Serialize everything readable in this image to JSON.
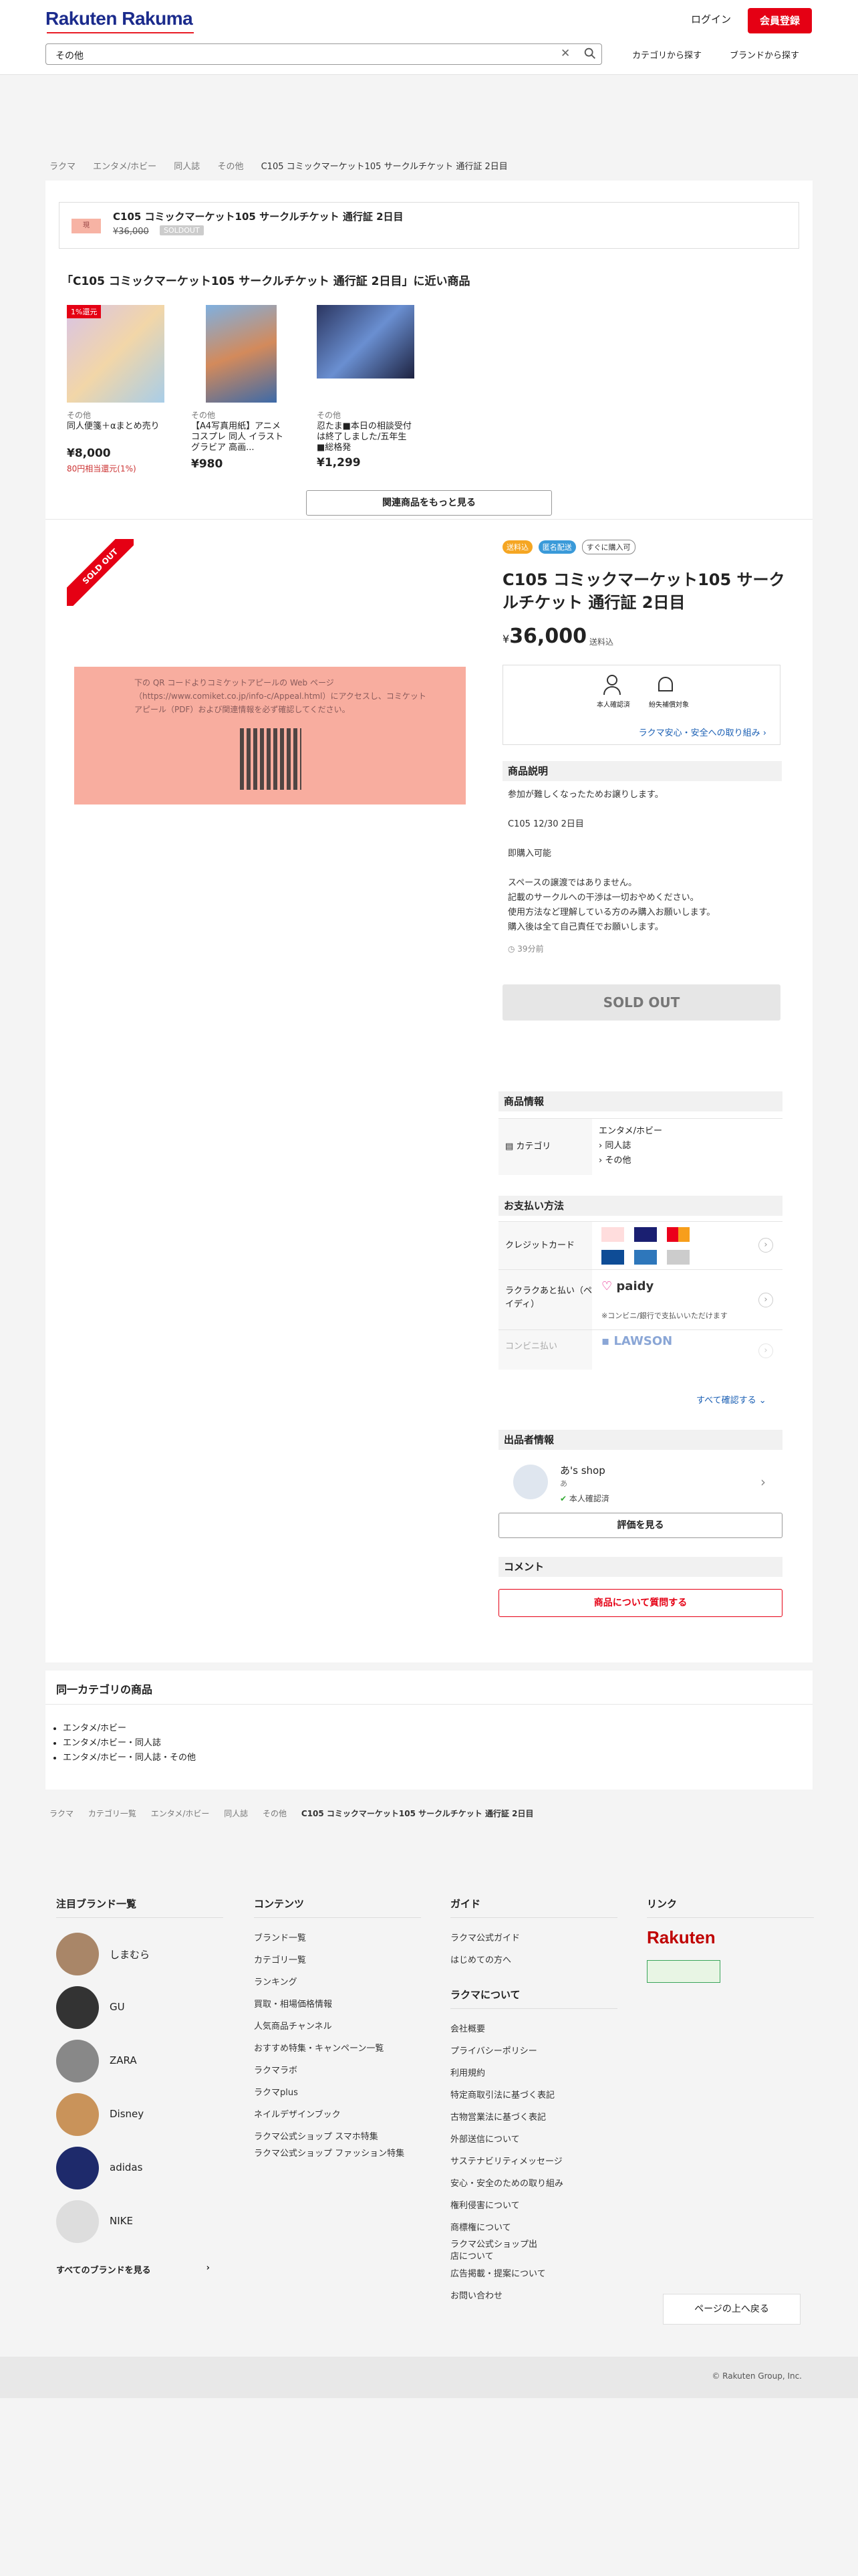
{
  "header": {
    "logo": "Rakuten Rakuma",
    "login": "ログイン",
    "register": "会員登録",
    "search_value": "その他",
    "nav_category": "カテゴリから探す",
    "nav_brand": "ブランドから探す"
  },
  "breadcrumb": [
    "ラクマ",
    "エンタメ/ホビー",
    "同人誌",
    "その他",
    "C105 コミックマーケット105 サークルチケット 通行証 2日目"
  ],
  "mini": {
    "thumb": "現",
    "title": "C105 コミックマーケット105 サークルチケット 通行証 2日目",
    "price": "¥36,000",
    "badge": "SOLDOUT"
  },
  "similar": {
    "title": "「C105 コミックマーケット105 サークルチケット 通行証 2日目」に近い商品",
    "items": [
      {
        "badge": "1%還元",
        "category": "その他",
        "name": "同人便箋＋αまとめ売り",
        "price": "¥8,000",
        "note": "80円相当還元(1%)",
        "color": "#c9b6d6"
      },
      {
        "category": "その他",
        "name": "【A4写真用紙】アニメ コスプレ 同人 イラスト グラビア 高画...",
        "price": "¥980",
        "color": "#3d6aa8"
      },
      {
        "category": "その他",
        "name": "忍たま■本日の相談受付は終了しました/五年生■総格発",
        "price": "¥1,299",
        "color": "#2b3560"
      }
    ],
    "more_button": "関連商品をもっと見る"
  },
  "product": {
    "ribbon": "SOLD OUT",
    "photo_text": "下の QR コードよりコミケットアピールの Web ページ（https://www.comiket.co.jp/info-c/Appeal.html）にアクセスし、コミケットアピール（PDF）および関連情報を必ず確認してください。",
    "tags": [
      "送料込",
      "匿名配送",
      "すぐに購入可"
    ],
    "title": "C105 コミックマーケット105 サークルチケット 通行証 2日目",
    "currency": "¥",
    "price": "36,000",
    "price_note": "送料込",
    "safe_labels": [
      "本人確認済",
      "紛失補償対象"
    ],
    "safe_link": "ラクマ安心・安全への取り組み",
    "desc_head": "商品説明",
    "desc_lines": [
      "参加が難しくなったためお譲りします。",
      "",
      "C105 12/30 2日目",
      "",
      "即購入可能",
      "",
      "スペースの譲渡ではありません。",
      "記載のサークルへの干渉は一切おやめください。",
      "使用方法など理解している方のみ購入お願いします。",
      "購入後は全て自己責任でお願いします。"
    ],
    "time": "39分前",
    "soldout": "SOLD OUT"
  },
  "info": {
    "head": "商品情報",
    "category_label": "カテゴリ",
    "category_values": [
      "エンタメ/ホビー",
      "同人誌",
      "その他"
    ]
  },
  "payment": {
    "head": "お支払い方法",
    "credit": "クレジットカード",
    "later": "ラクラクあと払い（ペイディ）",
    "later_note": "※コンビニ/銀行で支払いいただけます",
    "conv": "コンビニ払い",
    "see_all": "すべて確認する"
  },
  "seller": {
    "head": "出品者情報",
    "name": "あ's shop",
    "sub": "あ",
    "verify": "本人確認済",
    "eval_button": "評価を見る"
  },
  "comment": {
    "head": "コメント",
    "button": "商品について質問する"
  },
  "samecat": {
    "title": "同一カテゴリの商品",
    "items": [
      "エンタメ/ホビー",
      "エンタメ/ホビー・同人誌",
      "エンタメ/ホビー・同人誌・その他"
    ]
  },
  "breadcrumb2": [
    "ラクマ",
    "カテゴリ一覧",
    "エンタメ/ホビー",
    "同人誌",
    "その他",
    "C105 コミックマーケット105 サークルチケット 通行証 2日目"
  ],
  "footer": {
    "brands_head": "注目ブランド一覧",
    "brands": [
      "しまむら",
      "GU",
      "ZARA",
      "Disney",
      "adidas",
      "NIKE"
    ],
    "all_brands": "すべてのブランドを見る",
    "contents_head": "コンテンツ",
    "contents": [
      "ブランド一覧",
      "カテゴリ一覧",
      "ランキング",
      "買取・相場価格情報",
      "人気商品チャンネル",
      "おすすめ特集・キャンペーン一覧",
      "ラクマラボ",
      "ラクマplus",
      "ネイルデザインブック",
      "ラクマ公式ショップ スマホ特集",
      "ラクマ公式ショップ ファッション特集"
    ],
    "guide_head": "ガイド",
    "guide": [
      "ラクマ公式ガイド",
      "はじめての方へ"
    ],
    "about_head": "ラクマについて",
    "about": [
      "会社概要",
      "プライバシーポリシー",
      "利用規約",
      "特定商取引法に基づく表記",
      "古物営業法に基づく表記",
      "外部送信について",
      "サステナビリティメッセージ",
      "安心・安全のための取り組み",
      "権利侵害について",
      "商標権について",
      "ラクマ公式ショップ出店について",
      "広告掲載・提案について",
      "お問い合わせ"
    ],
    "link_head": "リンク",
    "rakuten": "Rakuten",
    "top_button": "ページの上へ戻る",
    "copyright": "© Rakuten Group, Inc."
  }
}
